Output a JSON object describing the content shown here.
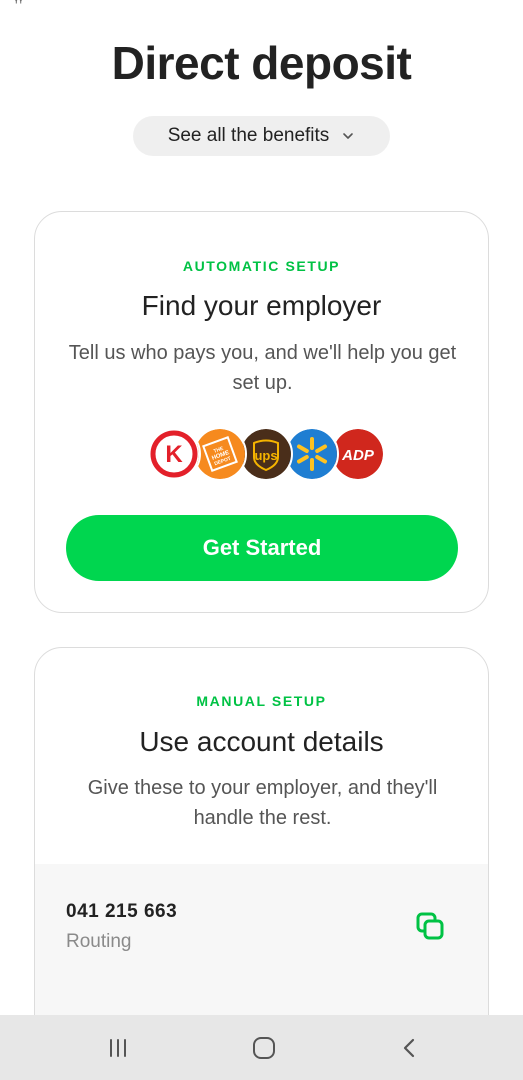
{
  "status_fragment": "ᵞᵞ",
  "header": {
    "title": "Direct deposit",
    "benefits_label": "See all the benefits"
  },
  "automatic": {
    "eyebrow": "AUTOMATIC SETUP",
    "title": "Find your employer",
    "description": "Tell us who pays you, and we'll help you get set up.",
    "logos": [
      {
        "name": "Circle K",
        "text": "K",
        "bg": "#ffffff",
        "fg": "#e3202a"
      },
      {
        "name": "The Home Depot",
        "text": "THE HOME DEPOT",
        "bg": "#f68a1e",
        "fg": "#ffffff"
      },
      {
        "name": "UPS",
        "text": "ups",
        "bg": "#4a2e1a",
        "fg": "#f5b400"
      },
      {
        "name": "Walmart",
        "text": "",
        "bg": "#1f7ed2",
        "fg": "#ffc220"
      },
      {
        "name": "ADP",
        "text": "ADP",
        "bg": "#d0271d",
        "fg": "#ffffff"
      }
    ],
    "button_label": "Get Started"
  },
  "manual": {
    "eyebrow": "MANUAL SETUP",
    "title": "Use account details",
    "description": "Give these to your employer, and they'll handle the rest.",
    "routing_number": "041 215 663",
    "routing_label": "Routing"
  },
  "colors": {
    "accent": "#00d64f",
    "eyebrow": "#00c244",
    "nav_bg": "#e7e7e7"
  },
  "nav": {
    "icons": [
      "recent-apps-icon",
      "home-icon",
      "back-icon"
    ]
  }
}
